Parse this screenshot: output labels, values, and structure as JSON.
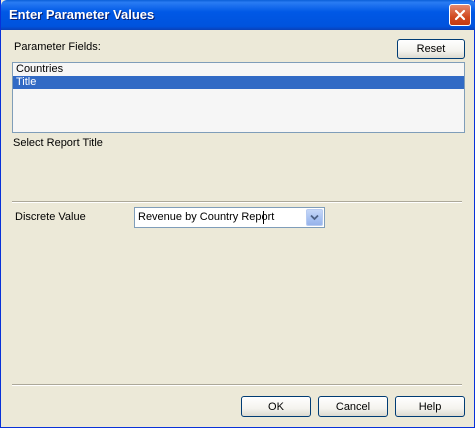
{
  "window": {
    "title": "Enter Parameter Values"
  },
  "parameters": {
    "label": "Parameter Fields:",
    "reset_label": "Reset",
    "items": [
      {
        "label": "Countries",
        "selected": false
      },
      {
        "label": "Title",
        "selected": true
      }
    ],
    "description": "Select Report Title"
  },
  "value": {
    "label": "Discrete Value",
    "selected_value": "Revenue by Country Report"
  },
  "footer": {
    "ok_label": "OK",
    "cancel_label": "Cancel",
    "help_label": "Help"
  },
  "colors": {
    "titlebar": "#0054e3",
    "selection": "#316ac5",
    "dialog_bg": "#ece9d8"
  },
  "icons": {
    "close": "close-icon",
    "dropdown": "chevron-down-icon"
  }
}
